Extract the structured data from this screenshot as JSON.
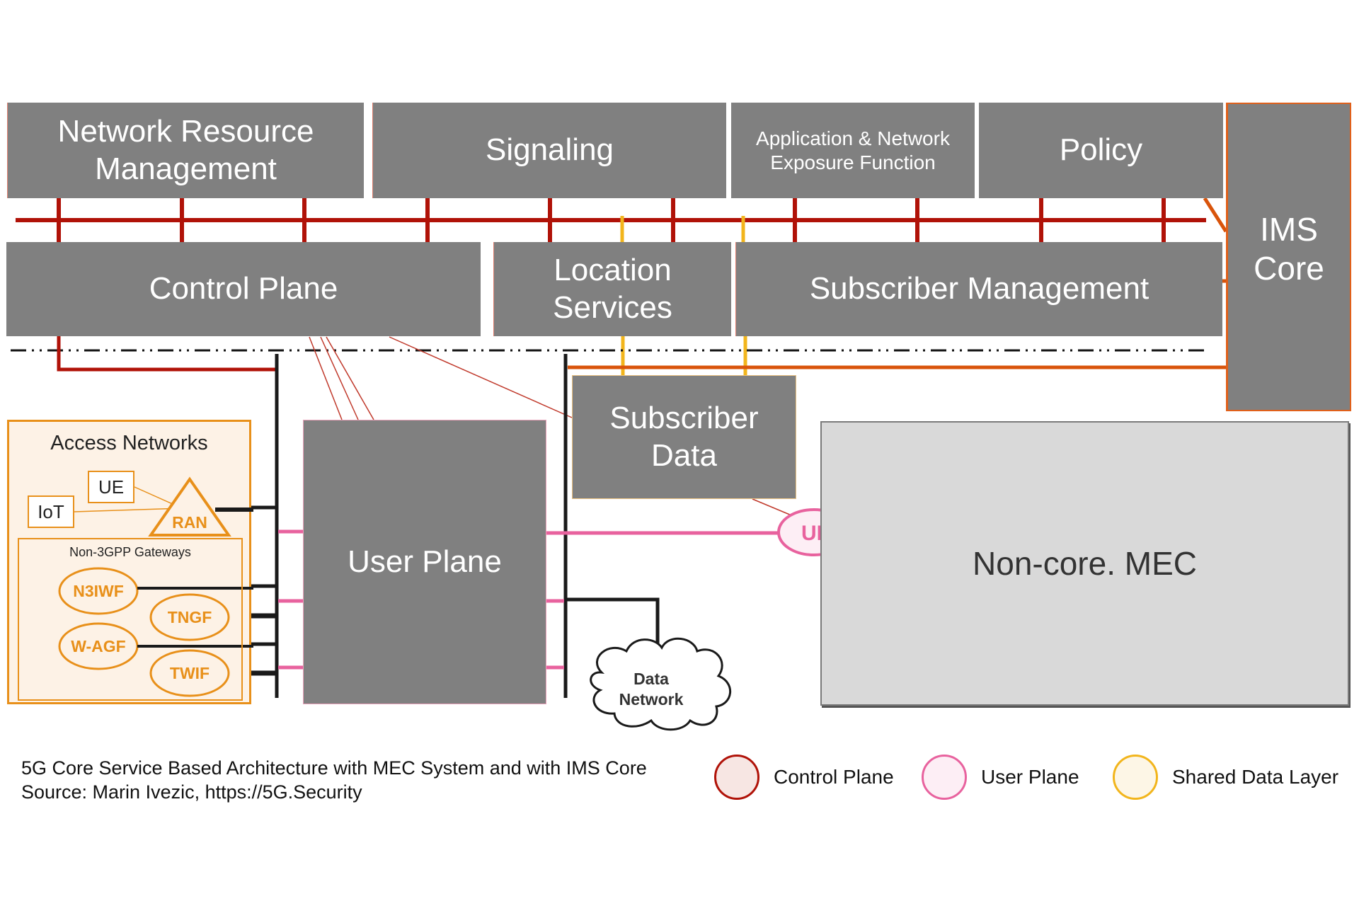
{
  "diagram": {
    "title": "5G Core Service Based Architecture with MEC System and with IMS Core",
    "source": "Source: Marin Ivezic, https://5G.Security"
  },
  "functions": {
    "network_resource_management": "Network Resource\nManagement",
    "signaling": "Signaling",
    "application_network_exposure": "Application & Network\nExposure Function",
    "policy": "Policy",
    "ims_core": "IMS\nCore",
    "control_plane": "Control Plane",
    "location_services": "Location\nServices",
    "subscriber_management": "Subscriber Management",
    "user_plane": "User Plane",
    "subscriber_data": "Subscriber\nData",
    "non_core_mec": "Non-core. MEC",
    "upf": "UPF",
    "data_network_line1": "Data",
    "data_network_line2": "Network"
  },
  "access_networks": {
    "title": "Access Networks",
    "ue": "UE",
    "iot": "IoT",
    "ran": "RAN",
    "non3gpp_title": "Non-3GPP Gateways",
    "gateways": [
      "N3IWF",
      "TNGF",
      "W-AGF",
      "TWIF"
    ]
  },
  "legend": [
    {
      "label": "Control Plane",
      "stroke": "#b01208",
      "fill": "#f7e6e3"
    },
    {
      "label": "User Plane",
      "stroke": "#e8629e",
      "fill": "#fdeef5"
    },
    {
      "label": "Shared Data Layer",
      "stroke": "#f2b51c",
      "fill": "#fdf6e6"
    }
  ],
  "colors": {
    "control_plane": "#b01208",
    "user_plane": "#e8629e",
    "shared_data": "#f2b51c",
    "ims_link": "#d9540b",
    "function_box": "#808080",
    "access_accent": "#e8901a"
  }
}
